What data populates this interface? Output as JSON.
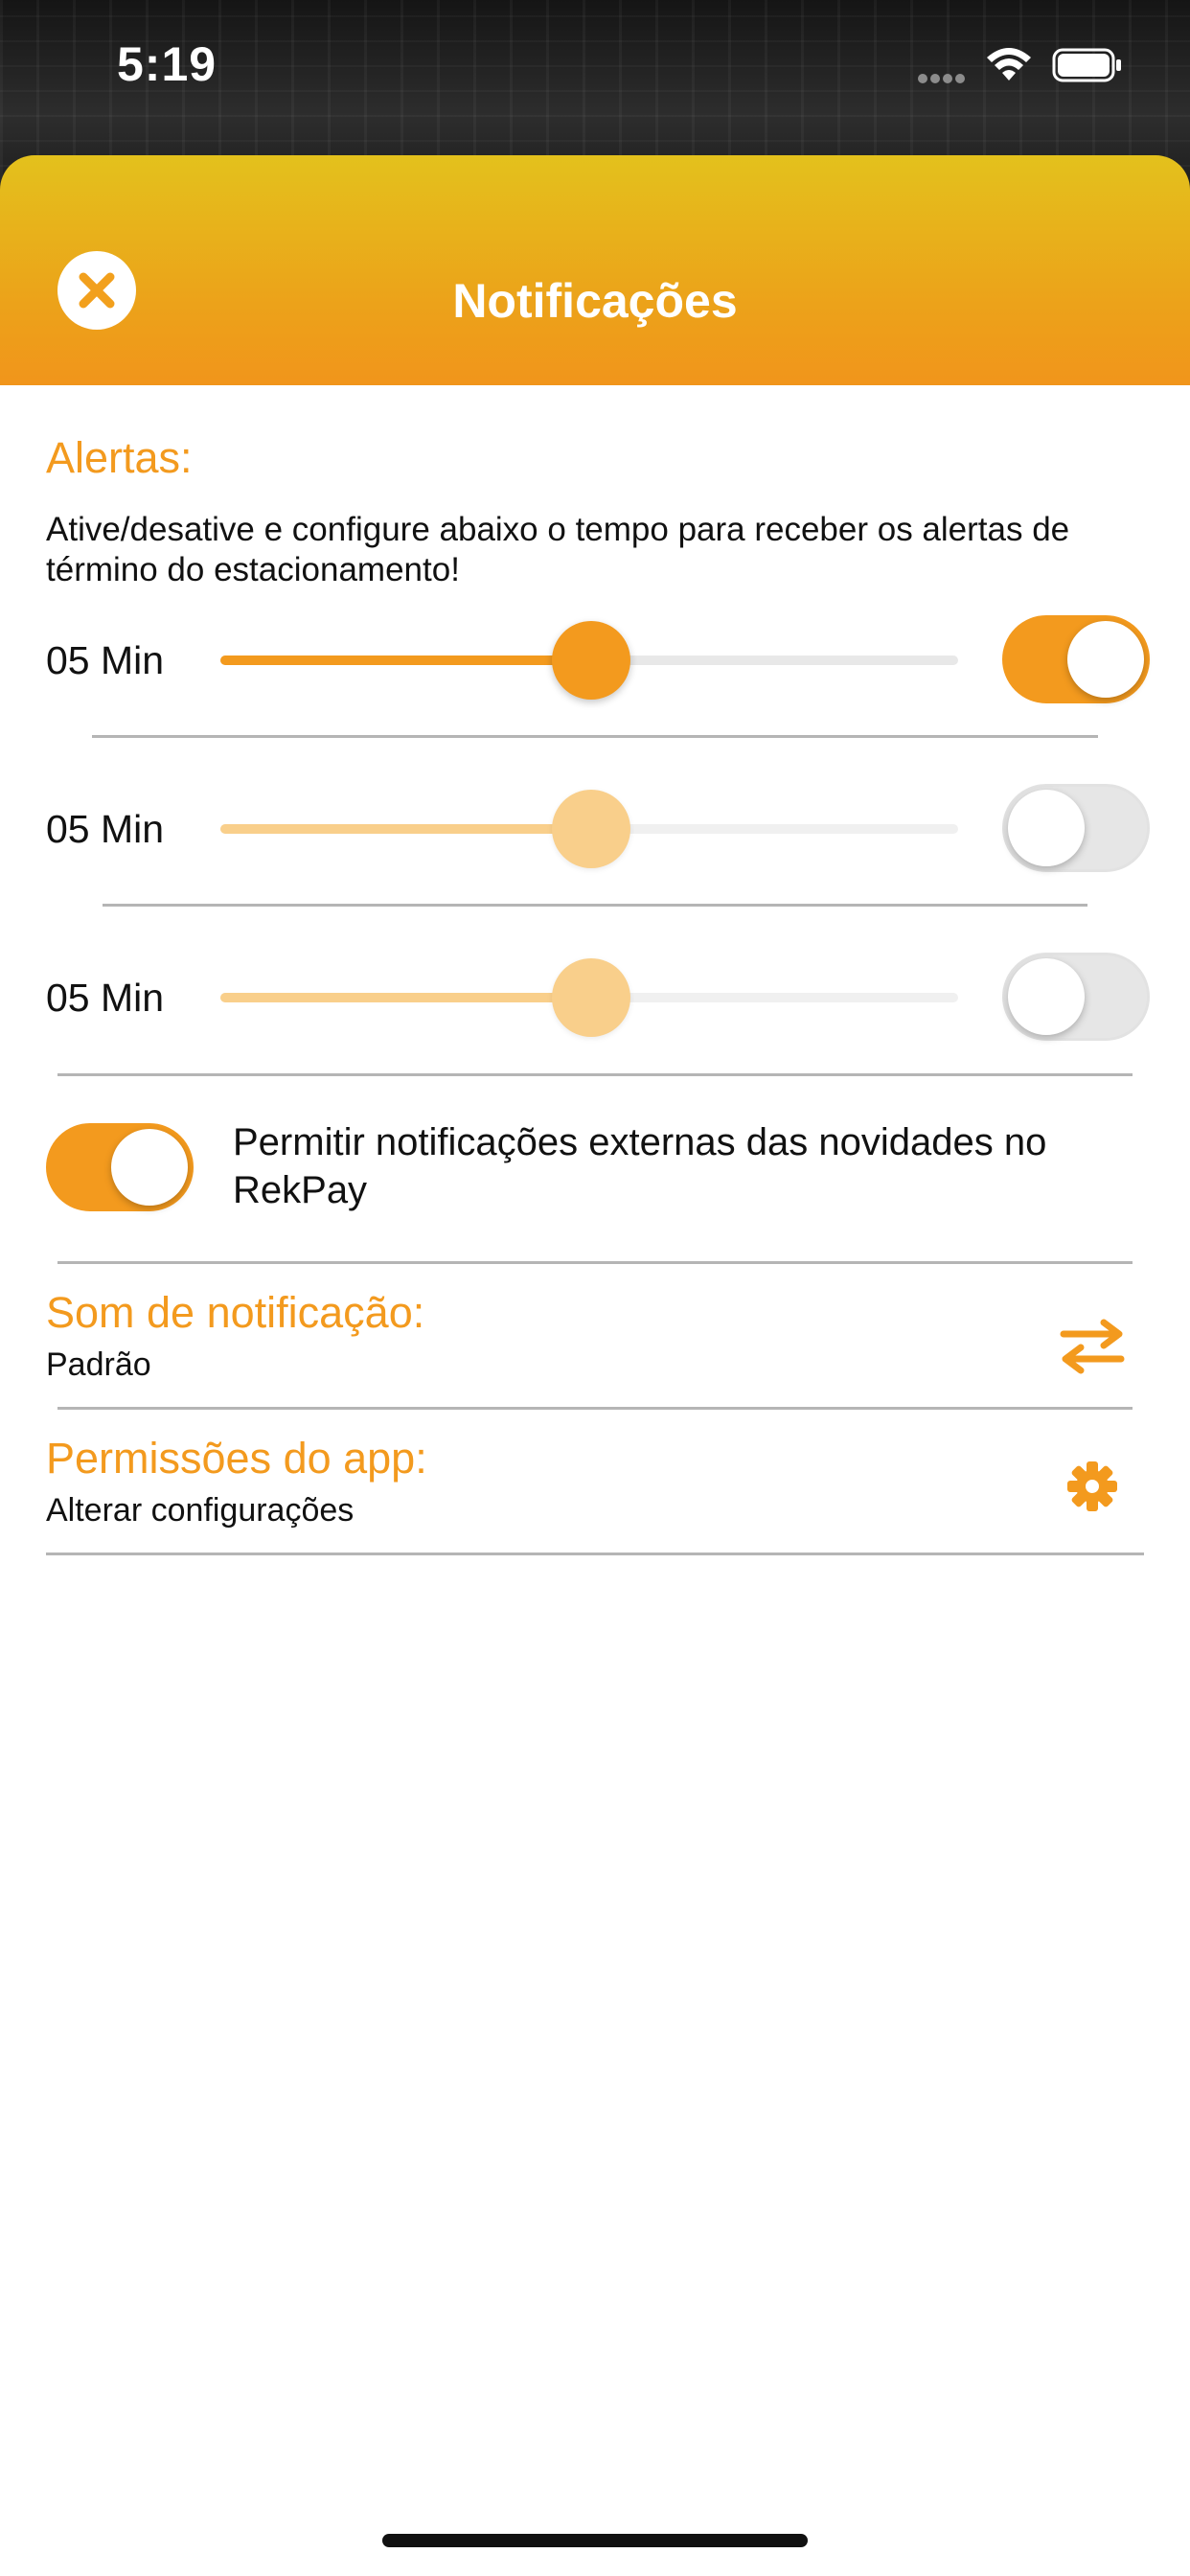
{
  "status_bar": {
    "time": "5:19"
  },
  "header": {
    "title": "Notificações",
    "close_icon": "close-circle-icon"
  },
  "alerts": {
    "title": "Alertas:",
    "description": "Ative/desative e configure abaixo o tempo para receber os alertas de término do estacionamento!",
    "rows": [
      {
        "label": "05 Min",
        "slider_level": 0.5,
        "enabled": true
      },
      {
        "label": "05 Min",
        "slider_level": 0.5,
        "enabled": false
      },
      {
        "label": "05 Min",
        "slider_level": 0.5,
        "enabled": false
      }
    ]
  },
  "external": {
    "label": "Permitir notificações externas das novidades no RekPay",
    "enabled": true
  },
  "sound": {
    "title": "Som de notificação:",
    "value": "Padrão",
    "icon": "swap-arrows-icon"
  },
  "permissions": {
    "title": "Permissões do app:",
    "value": "Alterar configurações",
    "icon": "gear-icon"
  },
  "colors": {
    "accent": "#f39a1e",
    "header_top": "#e3c11c",
    "header_bottom": "#f1951b",
    "disabled_accent": "#f9cf8b"
  }
}
